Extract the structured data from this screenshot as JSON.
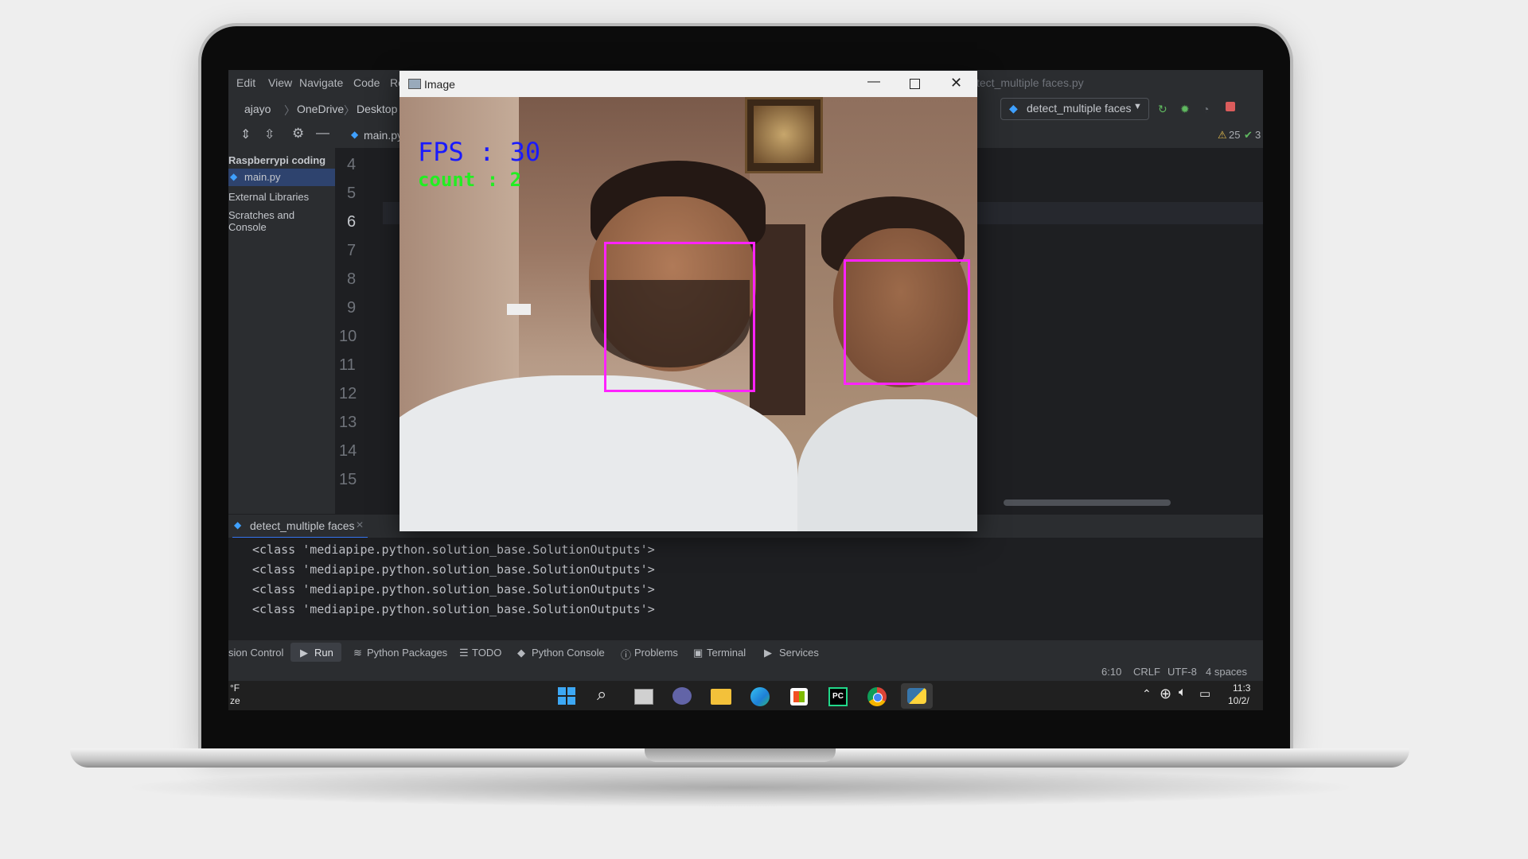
{
  "ide": {
    "menu": [
      "Edit",
      "View",
      "Navigate",
      "Code",
      "Re"
    ],
    "breadcrumbs": [
      "ajayo",
      "OneDrive",
      "Desktop"
    ],
    "file_tab": "main.py",
    "run_config": "detect_multiple faces",
    "project_tree": [
      "Raspberrypi coding",
      "main.py",
      "External Libraries",
      "Scratches and Console"
    ],
    "line_numbers": [
      "4",
      "5",
      "6",
      "7",
      "8",
      "9",
      "10",
      "11",
      "12",
      "13",
      "14",
      "15"
    ],
    "inspections": {
      "warnings": "25",
      "ok": "3"
    },
    "faded_title": "tect_multiple faces.py"
  },
  "camera_window": {
    "title": "Image",
    "overlay": {
      "fps": "FPS : 30",
      "count": "count : 2"
    },
    "colors": {
      "fps": "#1a1aff",
      "count": "#22ee22",
      "box": "#ff22ff"
    }
  },
  "run_panel": {
    "tab_label": "detect_multiple faces",
    "output": [
      "<class 'mediapipe.python.solution_base.SolutionOutputs'>",
      "<class 'mediapipe.python.solution_base.SolutionOutputs'>",
      "<class 'mediapipe.python.solution_base.SolutionOutputs'>",
      "<class 'mediapipe.python.solution_base.SolutionOutputs'>"
    ]
  },
  "tool_windows": [
    "sion Control",
    "Run",
    "Python Packages",
    "TODO",
    "Python Console",
    "Problems",
    "Terminal",
    "Services"
  ],
  "status_bar": {
    "position": "6:10",
    "line_sep": "CRLF",
    "encoding": "UTF-8",
    "indent": "4 spaces"
  },
  "taskbar": {
    "weather_1": "°F",
    "weather_2": "ze",
    "time": "11:3",
    "date": "10/2/"
  }
}
